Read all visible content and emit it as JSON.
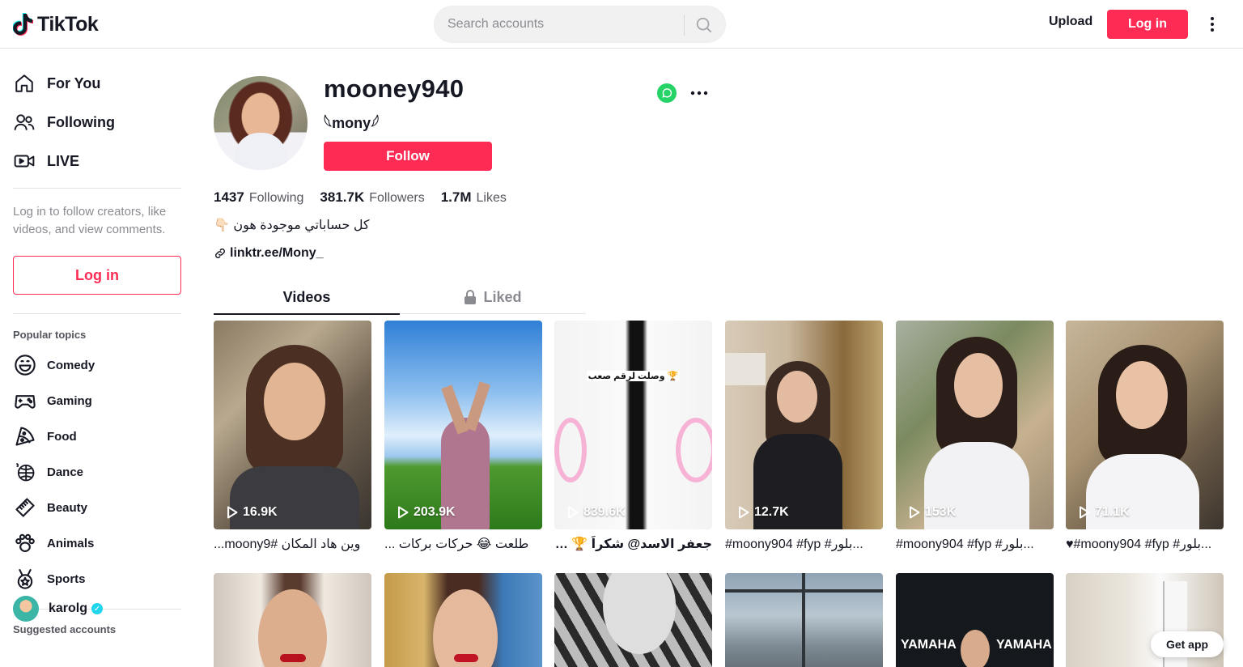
{
  "header": {
    "logo_text": "TikTok",
    "search_placeholder": "Search accounts",
    "upload_label": "Upload",
    "login_label": "Log in"
  },
  "sidebar": {
    "nav": [
      {
        "label": "For You",
        "icon": "home-icon"
      },
      {
        "label": "Following",
        "icon": "people-icon"
      },
      {
        "label": "LIVE",
        "icon": "live-icon"
      }
    ],
    "login_hint": "Log in to follow creators, like videos, and view comments.",
    "login_label": "Log in",
    "popular_topics_title": "Popular topics",
    "topics": [
      {
        "label": "Comedy",
        "icon": "smile-icon"
      },
      {
        "label": "Gaming",
        "icon": "gamepad-icon"
      },
      {
        "label": "Food",
        "icon": "pizza-icon"
      },
      {
        "label": "Dance",
        "icon": "disco-ball-icon"
      },
      {
        "label": "Beauty",
        "icon": "comb-icon"
      },
      {
        "label": "Animals",
        "icon": "paw-icon"
      },
      {
        "label": "Sports",
        "icon": "medal-icon"
      }
    ],
    "suggested_title": "Suggested accounts",
    "suggested": [
      {
        "name": "karolg",
        "verified": true
      }
    ]
  },
  "profile": {
    "username": "mooney940",
    "nickname": "𓆩mony𓆪",
    "follow_label": "Follow",
    "stats": {
      "following": "1437",
      "following_label": "Following",
      "followers": "381.7K",
      "followers_label": "Followers",
      "likes": "1.7M",
      "likes_label": "Likes"
    },
    "bio": "كل حساباتي موجودة هون 👇🏻",
    "link": "linktr.ee/Mony_"
  },
  "tabs": {
    "videos": "Videos",
    "liked": "Liked"
  },
  "videos": [
    {
      "views": "16.9K",
      "caption": "وين هاد المكان #moony9..."
    },
    {
      "views": "203.9K",
      "caption": "طلعت 😂 حركات بركات ..."
    },
    {
      "views": "839.6K",
      "caption": "جعفر الاسد@ شكراً 🏆 #mo..."
    },
    {
      "views": "12.7K",
      "caption": "#moony904 #fyp #بلور..."
    },
    {
      "views": "153K",
      "caption": "#moony904 #fyp #بلور..."
    },
    {
      "views": "71.1K",
      "caption": "♥#moony904 #fyp #بلور..."
    }
  ],
  "video3_overlay": "وصلت لرقم صعب 🏆",
  "video_row2_text": "YAMAHA",
  "get_app_label": "Get app",
  "colors": {
    "brand": "#fe2c55",
    "text": "#161823",
    "muted": "#8a8b91"
  }
}
